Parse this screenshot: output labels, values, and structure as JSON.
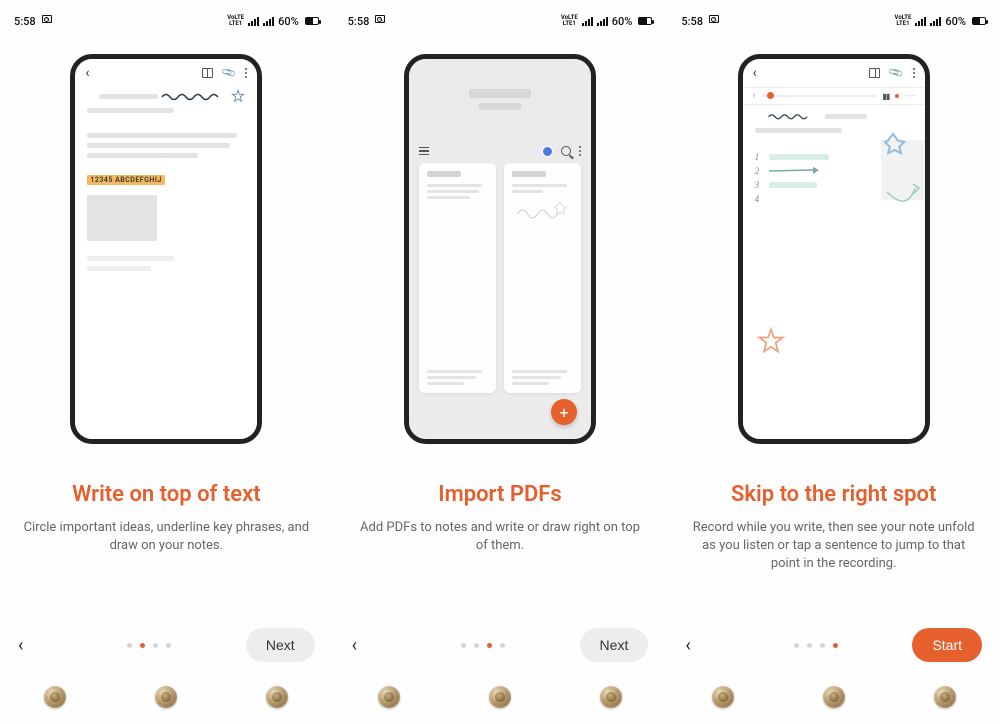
{
  "statusbar": {
    "time": "5:58",
    "battery_pct": "60%",
    "net": "VoLTE",
    "net2": "LTE1"
  },
  "panels": [
    {
      "heading": "Write on top of text",
      "body": "Circle important ideas, underline key phrases, and draw on your notes.",
      "highlight": "12345  ABCDEFGHIJ",
      "cta": "Next",
      "pager_active": 1,
      "pager_total": 4
    },
    {
      "heading": "Import PDFs",
      "body": "Add PDFs to notes and write or draw right on top of them.",
      "cta": "Next",
      "pager_active": 2,
      "pager_total": 4
    },
    {
      "heading": "Skip to the right spot",
      "body": "Record while you write, then see your note unfold as you listen or tap a sentence to jump to that point in the recording.",
      "cta": "Start",
      "pager_active": 3,
      "pager_total": 4,
      "list_numbers": [
        "1",
        "2",
        "3",
        "4"
      ]
    }
  ],
  "fab": "+"
}
